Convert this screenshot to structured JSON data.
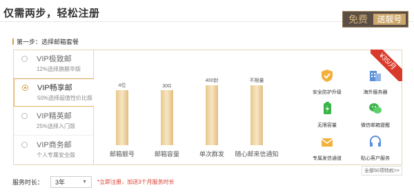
{
  "header": {
    "title": "仅需两步，轻松注册",
    "free_label": "免费",
    "gift_label": "送靓号"
  },
  "step": {
    "label": "第一步：选择邮箱套餐"
  },
  "plans": [
    {
      "name": "VIP极致邮",
      "desc": "12%选择旗舰华版",
      "selected": false
    },
    {
      "name": "VIP畅享邮",
      "desc": "50%选择超值性价比版",
      "selected": true
    },
    {
      "name": "VIP精英邮",
      "desc": "25%选择入门版",
      "selected": false
    },
    {
      "name": "VIP商务邮",
      "desc": "个人专属安全版",
      "selected": false
    }
  ],
  "chart_data": {
    "type": "bar",
    "categories": [
      "邮箱靓号",
      "邮箱容量",
      "单次群发",
      "随心邮来信通知"
    ],
    "data_labels": [
      "4位",
      "30G",
      "400封",
      "不限量"
    ],
    "relative_fill": [
      0.8,
      0.8,
      0.87,
      0.87
    ]
  },
  "features": [
    {
      "label": "安全防护升级",
      "icon": "shield-icon",
      "color": "#f3b03c"
    },
    {
      "label": "海外服务器",
      "icon": "server-icon",
      "color": "#5b8fd8"
    },
    {
      "label": "无限容量",
      "icon": "battery-icon",
      "color": "#3bb54a"
    },
    {
      "label": "微信邮箱提醒",
      "icon": "wechat-icon",
      "color": "#3bb54a"
    },
    {
      "label": "专属发信通道",
      "icon": "envelope-icon",
      "color": "#f3b03c"
    },
    {
      "label": "贴心客户服务",
      "icon": "headset-icon",
      "color": "#5b8fd8"
    }
  ],
  "price": {
    "text": "¥35/月"
  },
  "more": {
    "label": "全部50项特权>>"
  },
  "duration": {
    "label": "服务时长：",
    "selected": "3年",
    "promo": "*立即注册，加送3个月服务时长"
  },
  "colors": {
    "accent": "#d4a04c",
    "price_red": "#d93a2b",
    "badge_dark": "#5b4f45"
  }
}
